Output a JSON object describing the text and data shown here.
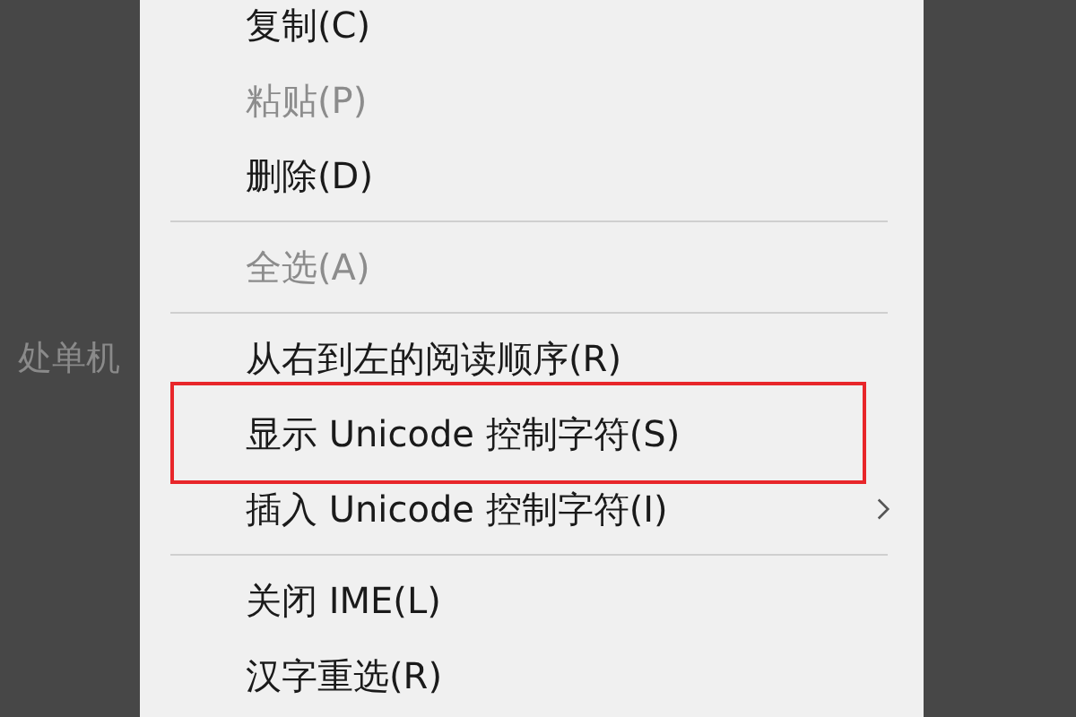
{
  "background": {
    "text": "处单机"
  },
  "menu": {
    "items": [
      {
        "kind": "item",
        "label": "复制(C)",
        "disabled": false,
        "has_submenu": false,
        "outlined": false
      },
      {
        "kind": "item",
        "label": "粘贴(P)",
        "disabled": true,
        "has_submenu": false,
        "outlined": false
      },
      {
        "kind": "item",
        "label": "删除(D)",
        "disabled": false,
        "has_submenu": false,
        "outlined": false
      },
      {
        "kind": "separator"
      },
      {
        "kind": "item",
        "label": "全选(A)",
        "disabled": true,
        "has_submenu": false,
        "outlined": false
      },
      {
        "kind": "separator"
      },
      {
        "kind": "item",
        "label": "从右到左的阅读顺序(R)",
        "disabled": false,
        "has_submenu": false,
        "outlined": false
      },
      {
        "kind": "item",
        "label": "显示 Unicode 控制字符(S)",
        "disabled": false,
        "has_submenu": false,
        "outlined": true
      },
      {
        "kind": "item",
        "label": "插入 Unicode 控制字符(I)",
        "disabled": false,
        "has_submenu": true,
        "outlined": false
      },
      {
        "kind": "separator"
      },
      {
        "kind": "item",
        "label": "关闭 IME(L)",
        "disabled": false,
        "has_submenu": false,
        "outlined": false
      },
      {
        "kind": "item",
        "label": "汉字重选(R)",
        "disabled": false,
        "has_submenu": false,
        "outlined": false
      }
    ]
  }
}
